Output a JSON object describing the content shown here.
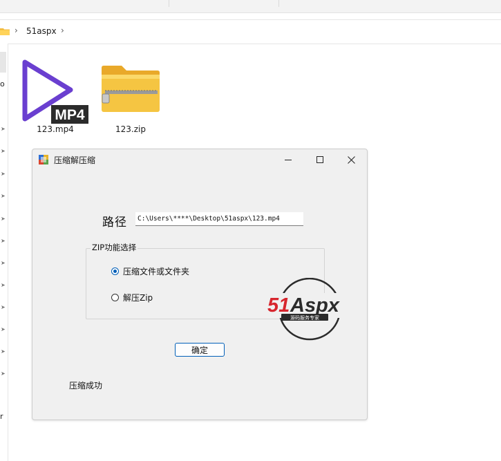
{
  "explorer": {
    "breadcrumb": {
      "folder": "51aspx"
    },
    "files": [
      {
        "name": "123.mp4",
        "icon": "mp4-video-icon"
      },
      {
        "name": "123.zip",
        "icon": "zip-folder-icon"
      }
    ],
    "nav_letters": [
      "o",
      "r"
    ]
  },
  "dialog": {
    "title": "压缩解压缩",
    "path_label": "路径",
    "path_value": "C:\\Users\\****\\Desktop\\51aspx\\123.mp4",
    "group_title": "ZIP功能选择",
    "options": [
      {
        "label": "压缩文件或文件夹",
        "checked": true
      },
      {
        "label": "解压Zip",
        "checked": false
      }
    ],
    "ok_label": "确定",
    "status": "压缩成功"
  },
  "watermark": {
    "brand": "51Aspx",
    "tagline": "源码服务专家",
    "colors": {
      "red": "#d7262e",
      "green": "#2a9b43",
      "dark": "#2b2b2b"
    }
  },
  "colors": {
    "accent": "#005fb8",
    "mp4_purple": "#6a3fd0",
    "zip_yellow": "#f5c542"
  }
}
